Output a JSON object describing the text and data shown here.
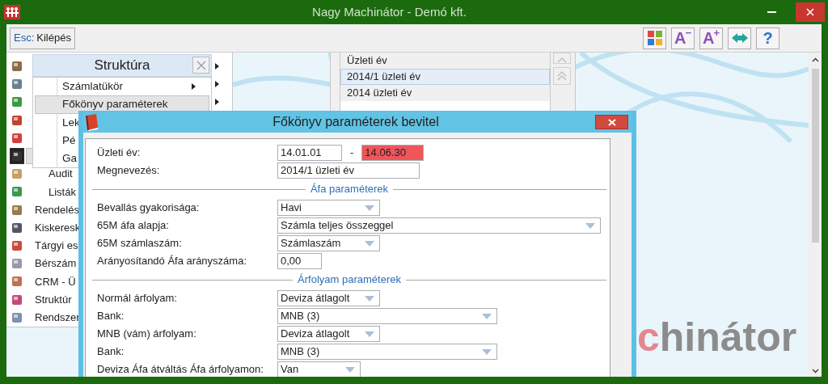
{
  "window": {
    "title": "Nagy Machinátor - Demó kft."
  },
  "toolbar": {
    "exit_button": {
      "key": "Esc:",
      "label": "Kilépés"
    },
    "buttons": [
      {
        "kind": "tiles"
      },
      {
        "kind": "glyph",
        "text": "A",
        "sup": "−"
      },
      {
        "kind": "glyph",
        "text": "A",
        "sup": "+"
      },
      {
        "kind": "arrows"
      },
      {
        "kind": "glyph",
        "text": "?"
      }
    ]
  },
  "sidebar": {
    "items": [
      {
        "selected": false,
        "submenu": true
      },
      {
        "selected": false,
        "submenu": true
      },
      {
        "selected": false,
        "submenu": true
      },
      {
        "selected": false,
        "submenu": false
      },
      {
        "selected": false,
        "submenu": false
      },
      {
        "selected": true,
        "submenu": false,
        "children": [
          {
            "label": "Audit"
          },
          {
            "label": "Listák"
          }
        ]
      },
      {
        "label": "Rendelés",
        "selected": false,
        "submenu": false
      },
      {
        "label": "Kiskeresk",
        "selected": false,
        "submenu": false
      },
      {
        "label": "Tárgyi es",
        "selected": false,
        "submenu": false
      },
      {
        "label": "Bérszám",
        "selected": false,
        "submenu": false
      },
      {
        "label": "CRM - Ü",
        "selected": false,
        "submenu": false
      },
      {
        "label": "Struktúr",
        "selected": false,
        "submenu": false
      },
      {
        "label": "Rendszer",
        "selected": false,
        "submenu": false
      }
    ]
  },
  "structure_menu": {
    "title": "Struktúra",
    "items": [
      {
        "label": "Számlatükör",
        "submenu": true,
        "selected": false
      },
      {
        "label": "Főkönyv paraméterek",
        "submenu": false,
        "selected": true
      },
      {
        "label": "Lek",
        "submenu": false,
        "selected": false
      },
      {
        "label": "Pé",
        "submenu": false,
        "selected": false
      },
      {
        "label": "Ga",
        "submenu": false,
        "selected": false
      }
    ]
  },
  "year_list": {
    "items": [
      {
        "label": "Üzleti év",
        "selected": false
      },
      {
        "label": "2014/1 üzleti év",
        "selected": true
      },
      {
        "label": "2014 üzleti év",
        "selected": false
      }
    ]
  },
  "background_logo": {
    "accent": "c",
    "rest": "hinátor"
  },
  "dialog": {
    "title": "Főkönyv paraméterek bevitel",
    "rows": [
      {
        "kind": "range",
        "label": "Üzleti év:",
        "from": "14.01.01",
        "separator": "-",
        "to": "14.06.30",
        "to_invalid": true
      },
      {
        "kind": "text",
        "label": "Megnevezés:",
        "value": "2014/1 üzleti év"
      },
      {
        "kind": "section",
        "title": "Áfa paraméterek"
      },
      {
        "kind": "select",
        "label": "Bevallás gyakorisága:",
        "value": "Havi"
      },
      {
        "kind": "select",
        "label": "65M áfa alapja:",
        "value": "Számla teljes összeggel"
      },
      {
        "kind": "select",
        "label": "65M számlaszám:",
        "value": "Számlaszám"
      },
      {
        "kind": "text",
        "label": "Arányosítandó Áfa arányszáma:",
        "value": "0,00"
      },
      {
        "kind": "section",
        "title": "Árfolyam paraméterek"
      },
      {
        "kind": "select",
        "label": "Normál árfolyam:",
        "value": "Deviza átlagolt"
      },
      {
        "kind": "select",
        "label": "Bank:",
        "value": "MNB (3)"
      },
      {
        "kind": "select",
        "label": "MNB (vám) árfolyam:",
        "value": "Deviza átlagolt"
      },
      {
        "kind": "select",
        "label": "Bank:",
        "value": "MNB (3)"
      },
      {
        "kind": "select",
        "label": "Deviza Áfa átváltás Áfa árfolyamon:",
        "value": "Van"
      }
    ]
  }
}
